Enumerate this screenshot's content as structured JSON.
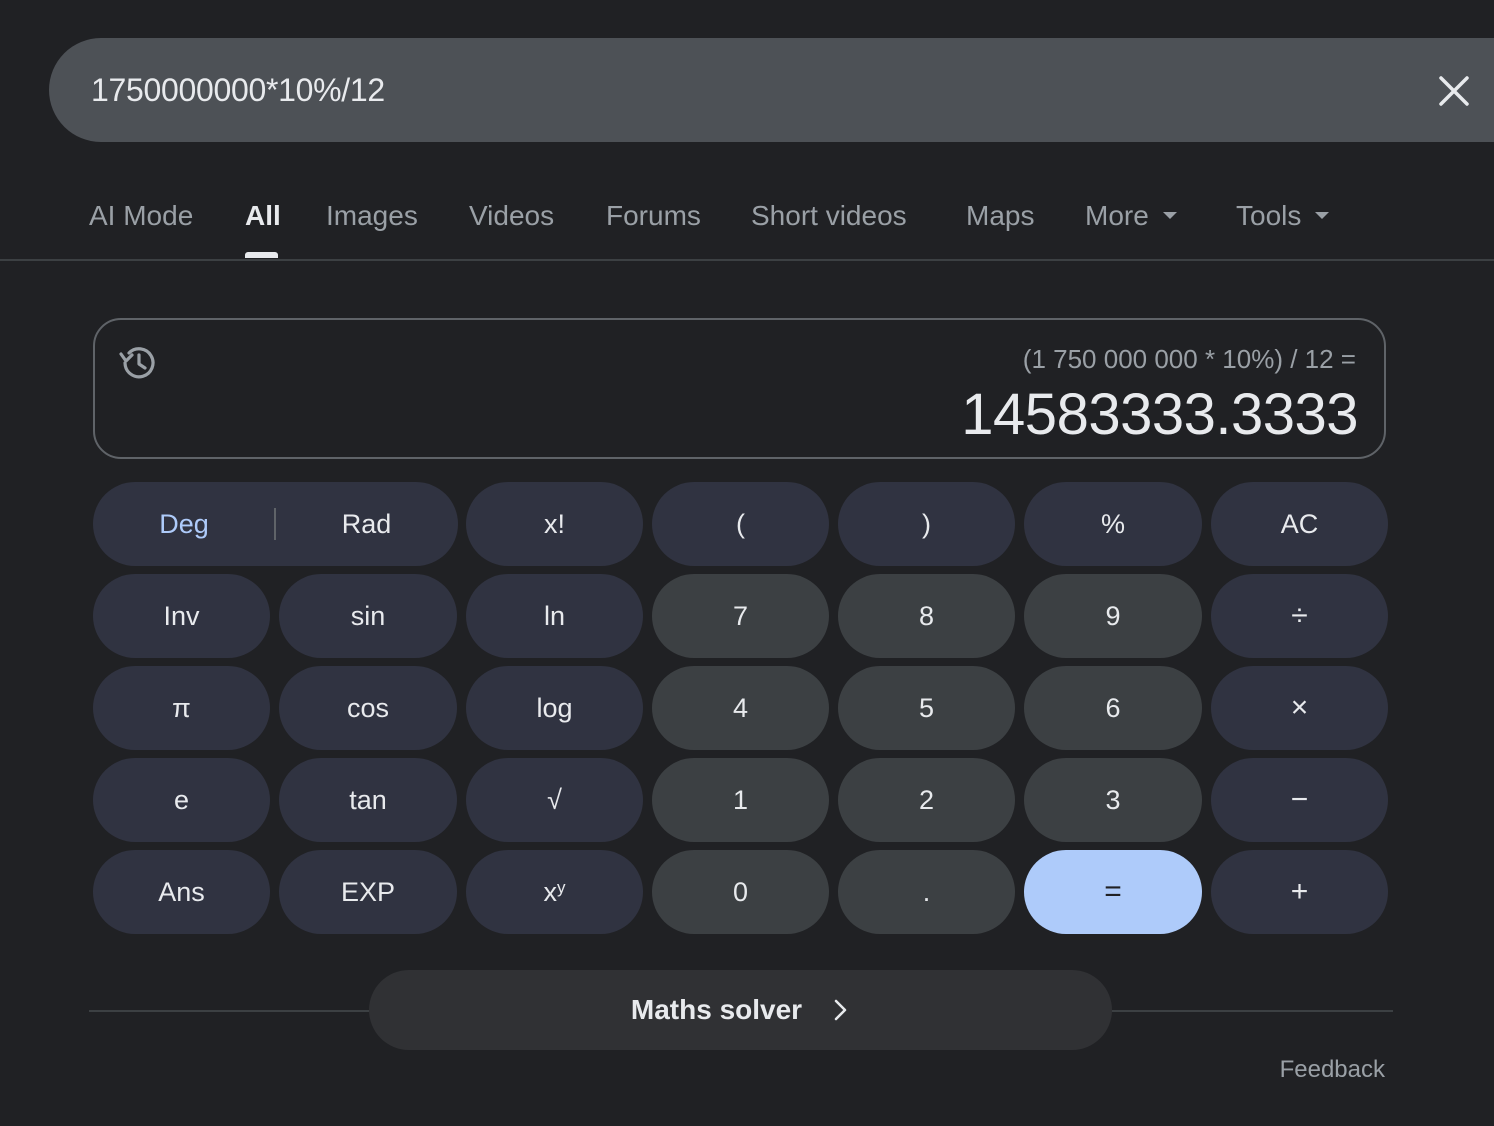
{
  "search": {
    "query": "1750000000*10%/12"
  },
  "tabs": [
    {
      "label": "AI Mode"
    },
    {
      "label": "All"
    },
    {
      "label": "Images"
    },
    {
      "label": "Videos"
    },
    {
      "label": "Forums"
    },
    {
      "label": "Short videos"
    },
    {
      "label": "Maps"
    },
    {
      "label": "More"
    },
    {
      "label": "Tools"
    }
  ],
  "active_tab": "All",
  "calculator": {
    "expression": "(1 750 000 000 * 10%) / 12 =",
    "result": "14583333.3333",
    "angle_mode": "Deg",
    "deg_label": "Deg",
    "rad_label": "Rad",
    "keys": {
      "fact": "x!",
      "lparen": "(",
      "rparen": ")",
      "percent": "%",
      "ac": "AC",
      "inv": "Inv",
      "sin": "sin",
      "ln": "ln",
      "d7": "7",
      "d8": "8",
      "d9": "9",
      "divide": "÷",
      "pi": "π",
      "cos": "cos",
      "log": "log",
      "d4": "4",
      "d5": "5",
      "d6": "6",
      "multiply": "×",
      "e": "e",
      "tan": "tan",
      "sqrt": "√",
      "d1": "1",
      "d2": "2",
      "d3": "3",
      "minus": "−",
      "ans": "Ans",
      "exp": "EXP",
      "pow_base": "x",
      "pow_exp": "y",
      "d0": "0",
      "dot": ".",
      "equals": "=",
      "plus": "+"
    }
  },
  "solver": {
    "label": "Maths solver"
  },
  "footer": {
    "feedback": "Feedback"
  },
  "colors": {
    "background": "#202124",
    "search_bar": "#4d5156",
    "function_key": "#303341",
    "number_key": "#3c4043",
    "equals_key": "#aecbfa",
    "accent": "#aecbfa"
  }
}
